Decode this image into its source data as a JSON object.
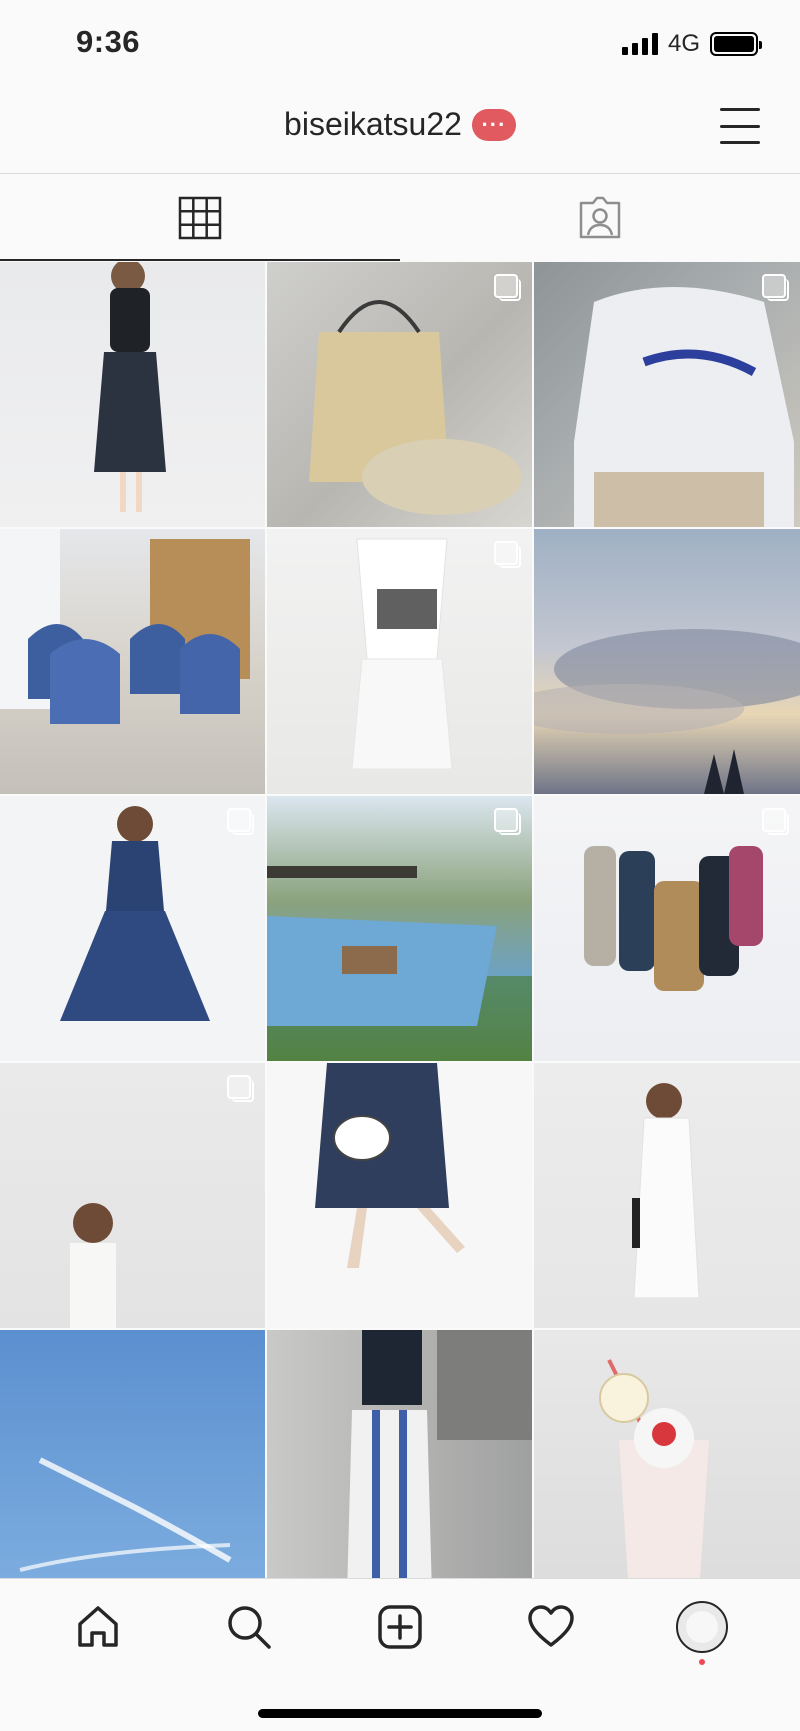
{
  "status_bar": {
    "time": "9:36",
    "network": "4G",
    "icons": [
      "signal-icon",
      "battery-icon"
    ]
  },
  "header": {
    "username": "biseikatsu22",
    "badge_label": "···",
    "menu_icon": "hamburger-menu-icon"
  },
  "tabs": [
    {
      "name": "grid-tab",
      "icon": "grid-icon",
      "active": true
    },
    {
      "name": "tagged-tab",
      "icon": "tagged-person-icon",
      "active": false
    }
  ],
  "posts": [
    {
      "multi": false
    },
    {
      "multi": true
    },
    {
      "multi": true
    },
    {
      "multi": false
    },
    {
      "multi": true
    },
    {
      "multi": false
    },
    {
      "multi": true
    },
    {
      "multi": true
    },
    {
      "multi": true
    },
    {
      "multi": true
    },
    {
      "multi": false
    },
    {
      "multi": false
    },
    {
      "multi": false
    },
    {
      "multi": false
    },
    {
      "multi": false
    }
  ],
  "bottom_nav": {
    "items": [
      "home-icon",
      "search-icon",
      "new-post-icon",
      "activity-heart-icon",
      "profile-avatar"
    ],
    "has_notification": true
  },
  "colors": {
    "badge": "#e05a5f",
    "text": "#262626",
    "notification_dot": "#ed4956"
  }
}
